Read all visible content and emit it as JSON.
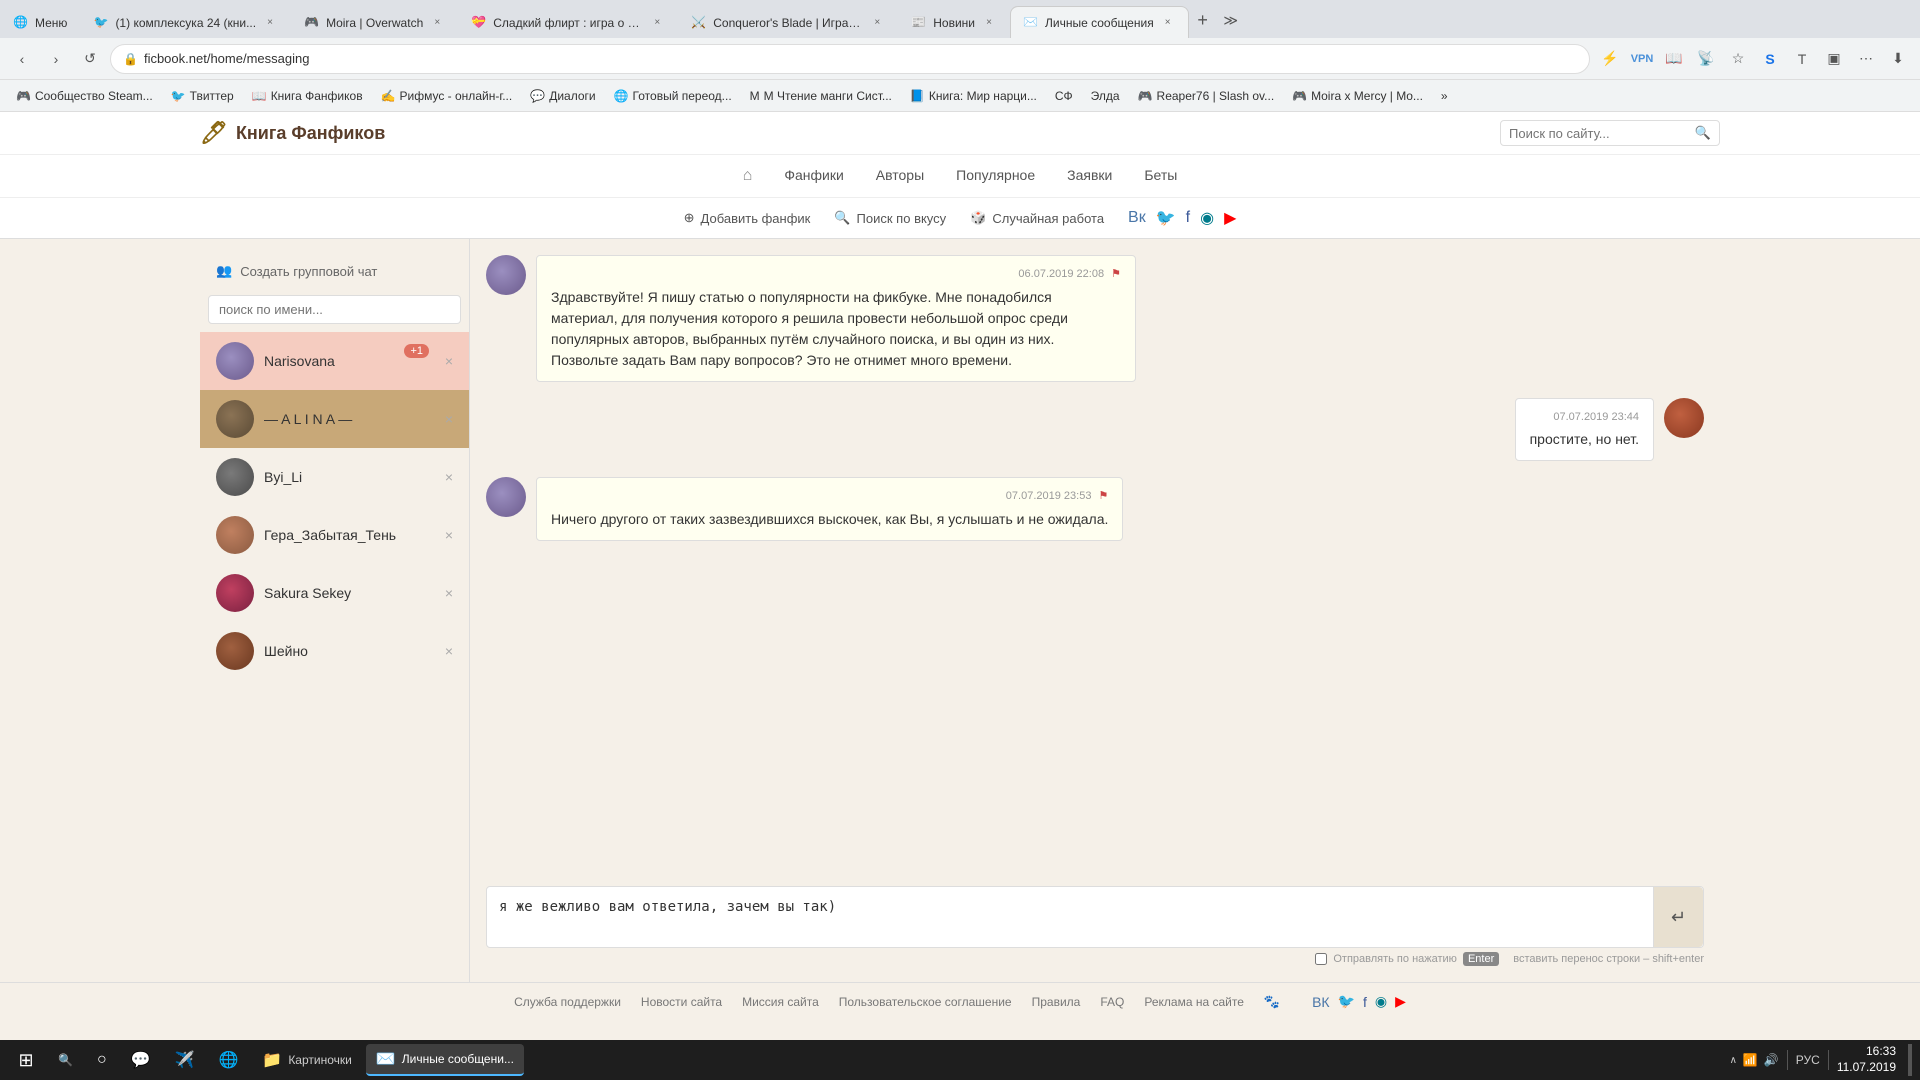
{
  "browser": {
    "tabs": [
      {
        "id": "tab1",
        "title": "Меню",
        "active": false,
        "favicon": "🌐",
        "color": ""
      },
      {
        "id": "tab2",
        "title": "(1) комплексука 24 (кни...",
        "active": false,
        "favicon": "🐦",
        "color": "tab-color-twitter"
      },
      {
        "id": "tab3",
        "title": "Moira | Overwatch",
        "active": false,
        "favicon": "🎮",
        "color": "tab-color-moira"
      },
      {
        "id": "tab4",
        "title": "Сладкий флирт : игра о л...",
        "active": false,
        "favicon": "💝",
        "color": "tab-color-flirt"
      },
      {
        "id": "tab5",
        "title": "Conqueror's Blade | Играй...",
        "active": false,
        "favicon": "⚔️",
        "color": "tab-color-conq"
      },
      {
        "id": "tab6",
        "title": "Новини",
        "active": false,
        "favicon": "📰",
        "color": "tab-color-news"
      },
      {
        "id": "tab7",
        "title": "Личные сообщения",
        "active": true,
        "favicon": "✉️",
        "color": "tab-color-msg"
      }
    ],
    "url": "ficbook.net/home/messaging",
    "url_full": "ficbook.net/home/messaging"
  },
  "bookmarks": [
    {
      "id": "bm1",
      "title": "Сообщество Steam...",
      "icon": "🎮"
    },
    {
      "id": "bm2",
      "title": "Твиттер",
      "icon": "🐦"
    },
    {
      "id": "bm3",
      "title": "Книга Фанфиков",
      "icon": "📖"
    },
    {
      "id": "bm4",
      "title": "Рифмус - онлайн-г...",
      "icon": "✍️"
    },
    {
      "id": "bm5",
      "title": "Диалоги",
      "icon": "💬"
    },
    {
      "id": "bm6",
      "title": "Готовый переод...",
      "icon": "🌐"
    },
    {
      "id": "bm7",
      "title": "M Чтение манги Сист...",
      "icon": "📚"
    },
    {
      "id": "bm8",
      "title": "Книга: Мир нарци...",
      "icon": "📘"
    },
    {
      "id": "bm9",
      "title": "СФ",
      "icon": "📄"
    },
    {
      "id": "bm10",
      "title": "Элда",
      "icon": "🔷"
    },
    {
      "id": "bm11",
      "title": "Reaper76 | Slash ov...",
      "icon": "🎮"
    },
    {
      "id": "bm12",
      "title": "Moira x Mercy | Mo...",
      "icon": "🎮"
    }
  ],
  "site": {
    "logo": "Книга Фанфиков",
    "search_placeholder": "Поиск по сайту...",
    "nav": [
      {
        "label": "Фанфики"
      },
      {
        "label": "Авторы"
      },
      {
        "label": "Популярное"
      },
      {
        "label": "Заявки"
      },
      {
        "label": "Беты"
      }
    ],
    "actions": [
      {
        "label": "Добавить фанфик",
        "icon": "⊕"
      },
      {
        "label": "Поиск по вкусу",
        "icon": "🔍"
      },
      {
        "label": "Случайная работа",
        "icon": "🎲"
      }
    ]
  },
  "contacts": {
    "create_group_label": "Создать групповой чат",
    "search_placeholder": "поиск по имени...",
    "list": [
      {
        "id": "narisovana",
        "name": "Narisovana",
        "badge": "+1",
        "avatar_class": "av-narisovana",
        "active": "narisovana"
      },
      {
        "id": "alina",
        "name": "— A L I N A —",
        "badge": "",
        "avatar_class": "av-alina",
        "active": "alina"
      },
      {
        "id": "byili",
        "name": "Byi_Li",
        "badge": "",
        "avatar_class": "av-byili",
        "active": ""
      },
      {
        "id": "gera",
        "name": "Гера_Забытая_Тень",
        "badge": "",
        "avatar_class": "av-gera",
        "active": ""
      },
      {
        "id": "sakura",
        "name": "Sakura Sekey",
        "badge": "",
        "avatar_class": "av-sakura",
        "active": ""
      },
      {
        "id": "sheino",
        "name": "Шейно",
        "badge": "",
        "avatar_class": "av-sheino",
        "active": ""
      }
    ]
  },
  "messages": [
    {
      "id": "msg1",
      "type": "incoming",
      "avatar_class": "av-msg1",
      "timestamp": "06.07.2019 22:08",
      "text": "Здравствуйте! Я пишу статью о популярности на фикбуке. Мне понадобился материал, для получения которого я решила провести небольшой опрос среди популярных авторов, выбранных путём случайного поиска, и вы один из них. Позвольте задать Вам пару вопросов? Это не отнимет много времени.",
      "has_flag": true
    },
    {
      "id": "msg2",
      "type": "outgoing",
      "avatar_class": "av-msg-out",
      "timestamp": "07.07.2019 23:44",
      "text": "простите, но нет.",
      "has_flag": false
    },
    {
      "id": "msg3",
      "type": "incoming",
      "avatar_class": "av-msg1",
      "timestamp": "07.07.2019 23:53",
      "text": "Ничего другого от таких зазвездившихся выскочек, как Вы, я услышать и не ожидала.",
      "has_flag": true
    }
  ],
  "compose": {
    "input_text": "я же вежливо вам ответила, зачем вы так)",
    "send_checkbox_label": "Отправлять по нажатию",
    "enter_label": "Enter",
    "hint": "вставить перенос строки – shift+enter"
  },
  "footer": {
    "links": [
      {
        "label": "Служба поддержки"
      },
      {
        "label": "Новости сайта"
      },
      {
        "label": "Миссия сайта"
      },
      {
        "label": "Пользовательское соглашение"
      },
      {
        "label": "Правила"
      },
      {
        "label": "FAQ"
      },
      {
        "label": "Реклама на сайте"
      }
    ]
  },
  "taskbar": {
    "start_icon": "⊞",
    "apps": [
      {
        "id": "search",
        "icon": "🔍"
      },
      {
        "id": "cortana",
        "icon": "○"
      },
      {
        "id": "skype",
        "icon": "💬"
      },
      {
        "id": "telegram",
        "icon": "✈️"
      },
      {
        "id": "browser",
        "icon": "🌐"
      },
      {
        "id": "file",
        "icon": "📁"
      }
    ],
    "active_app": {
      "label": "Личные сообщени...",
      "icon": "✉️"
    },
    "time": "16:33",
    "date": "11.07.2019",
    "lang": "РУС"
  }
}
